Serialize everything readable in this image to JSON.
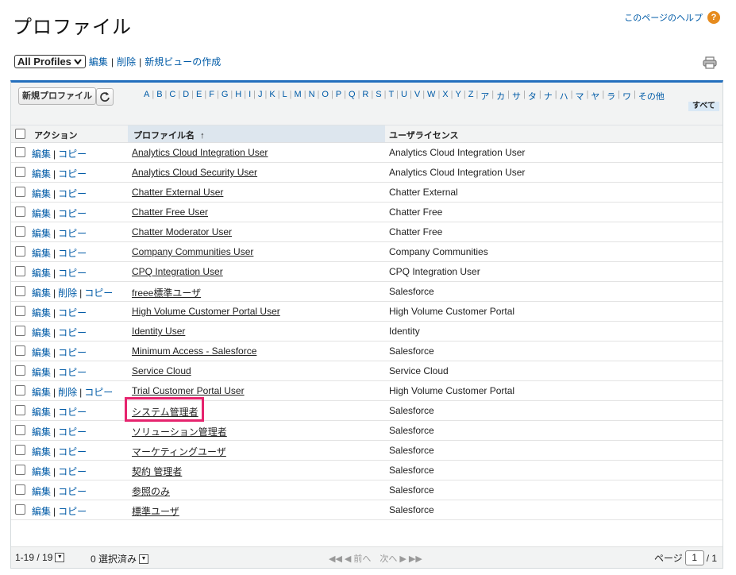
{
  "page": {
    "title": "プロファイル",
    "help_link": "このページのヘルプ"
  },
  "view": {
    "selected": "All Profiles",
    "edit": "編集",
    "delete": "削除",
    "new_view": "新規ビューの作成"
  },
  "toolbar": {
    "new_button": "新規プロファイル"
  },
  "alphabet": [
    "A",
    "B",
    "C",
    "D",
    "E",
    "F",
    "G",
    "H",
    "I",
    "J",
    "K",
    "L",
    "M",
    "N",
    "O",
    "P",
    "Q",
    "R",
    "S",
    "T",
    "U",
    "V",
    "W",
    "X",
    "Y",
    "Z",
    "ア",
    "カ",
    "サ",
    "タ",
    "ナ",
    "ハ",
    "マ",
    "ヤ",
    "ラ",
    "ワ",
    "その他"
  ],
  "alphabet_all": "すべて",
  "columns": {
    "action": "アクション",
    "profile_name": "プロファイル名",
    "sort_indicator": "↑",
    "license": "ユーザライセンス"
  },
  "actions": {
    "edit": "編集",
    "delete": "削除",
    "copy": "コピー"
  },
  "rows": [
    {
      "name": "Analytics Cloud Integration User",
      "license": "Analytics Cloud Integration User",
      "deletable": false
    },
    {
      "name": "Analytics Cloud Security User",
      "license": "Analytics Cloud Integration User",
      "deletable": false
    },
    {
      "name": "Chatter External User",
      "license": "Chatter External",
      "deletable": false
    },
    {
      "name": "Chatter Free User",
      "license": "Chatter Free",
      "deletable": false
    },
    {
      "name": "Chatter Moderator User",
      "license": "Chatter Free",
      "deletable": false
    },
    {
      "name": "Company Communities User",
      "license": "Company Communities",
      "deletable": false
    },
    {
      "name": "CPQ Integration User",
      "license": "CPQ Integration User",
      "deletable": false
    },
    {
      "name": "freee標準ユーザ",
      "license": "Salesforce",
      "deletable": true
    },
    {
      "name": "High Volume Customer Portal User",
      "license": "High Volume Customer Portal",
      "deletable": false
    },
    {
      "name": "Identity User",
      "license": "Identity",
      "deletable": false
    },
    {
      "name": "Minimum Access - Salesforce",
      "license": "Salesforce",
      "deletable": false
    },
    {
      "name": "Service Cloud",
      "license": "Service Cloud",
      "deletable": false
    },
    {
      "name": "Trial Customer Portal User",
      "license": "High Volume Customer Portal",
      "deletable": true
    },
    {
      "name": "システム管理者",
      "license": "Salesforce",
      "deletable": false
    },
    {
      "name": "ソリューション管理者",
      "license": "Salesforce",
      "deletable": false
    },
    {
      "name": "マーケティングユーザ",
      "license": "Salesforce",
      "deletable": false
    },
    {
      "name": "契約 管理者",
      "license": "Salesforce",
      "deletable": false
    },
    {
      "name": "参照のみ",
      "license": "Salesforce",
      "deletable": false
    },
    {
      "name": "標準ユーザ",
      "license": "Salesforce",
      "deletable": false
    }
  ],
  "footer": {
    "range": "1-19 / 19",
    "selected": "0 選択済み",
    "prev": "前へ",
    "next": "次へ",
    "page_label": "ページ",
    "page": "1",
    "total_pages": "/ 1"
  },
  "colors": {
    "link": "#015ba7",
    "accent_border": "#236fbd",
    "highlight": "#e6246e",
    "help_icon": "#e68b1e"
  }
}
